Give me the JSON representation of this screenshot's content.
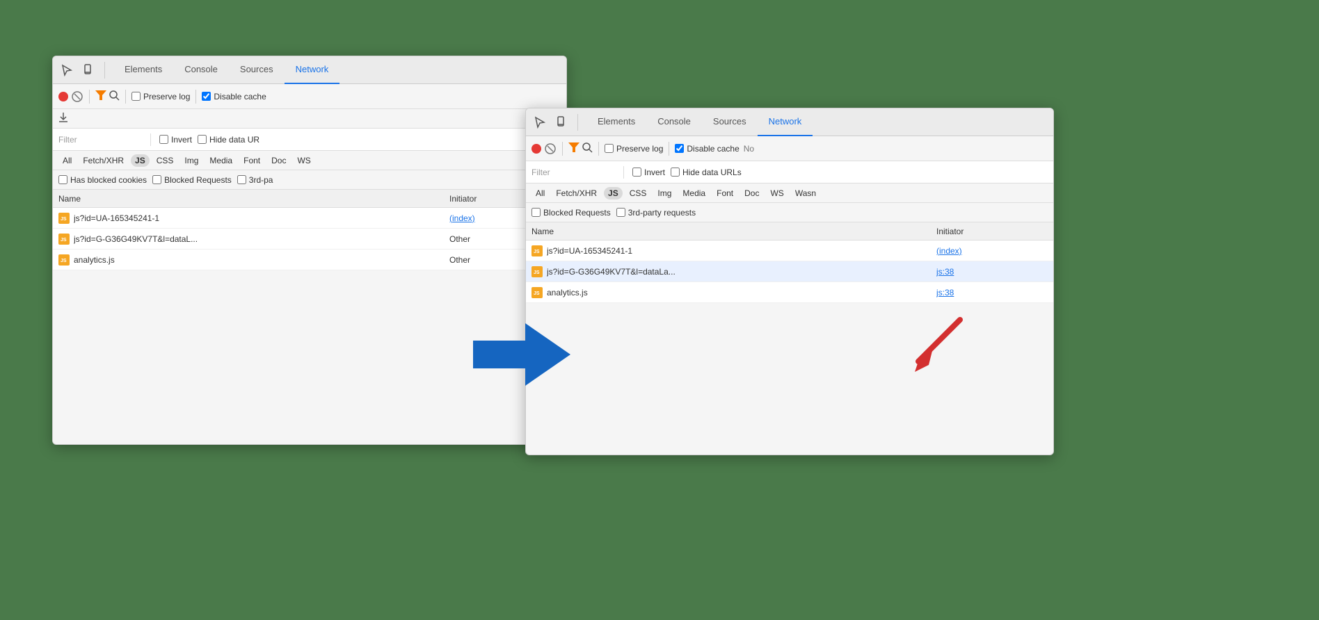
{
  "panel_back": {
    "tabs": [
      {
        "label": "Elements",
        "active": false
      },
      {
        "label": "Console",
        "active": false
      },
      {
        "label": "Sources",
        "active": false
      },
      {
        "label": "Network",
        "active": true
      }
    ],
    "toolbar": {
      "preserve_log": "Preserve log",
      "disable_cache": "Disable cache",
      "preserve_log_checked": false,
      "disable_cache_checked": true
    },
    "filter": {
      "placeholder": "Filter",
      "invert": "Invert",
      "hide_data_urls": "Hide data UR"
    },
    "type_filters": [
      "All",
      "Fetch/XHR",
      "JS",
      "CSS",
      "Img",
      "Media",
      "Font",
      "Doc",
      "WS"
    ],
    "js_active": true,
    "blocked_row": {
      "has_blocked": "Has blocked cookies",
      "blocked_requests": "Blocked Requests",
      "third_party": "3rd-pa"
    },
    "table": {
      "col_name": "Name",
      "col_initiator": "Initiator",
      "rows": [
        {
          "name": "js?id=UA-165345241-1",
          "initiator": "(index)",
          "initiator_link": true
        },
        {
          "name": "js?id=G-G36G49KV7T&l=dataL...",
          "initiator": "Other",
          "initiator_link": false
        },
        {
          "name": "analytics.js",
          "initiator": "Other",
          "initiator_link": false
        }
      ]
    }
  },
  "panel_front": {
    "tabs": [
      {
        "label": "Elements",
        "active": false
      },
      {
        "label": "Console",
        "active": false
      },
      {
        "label": "Sources",
        "active": false
      },
      {
        "label": "Network",
        "active": true
      }
    ],
    "toolbar": {
      "preserve_log": "Preserve log",
      "disable_cache": "Disable cache",
      "no_throttle": "No",
      "preserve_log_checked": false,
      "disable_cache_checked": true
    },
    "filter": {
      "placeholder": "Filter",
      "invert": "Invert",
      "hide_data_urls": "Hide data URLs"
    },
    "type_filters": [
      "All",
      "Fetch/XHR",
      "JS",
      "CSS",
      "Img",
      "Media",
      "Font",
      "Doc",
      "WS",
      "Wasn"
    ],
    "js_active": true,
    "blocked_row": {
      "blocked_requests": "Blocked Requests",
      "third_party": "3rd-party requests"
    },
    "table": {
      "col_name": "Name",
      "col_initiator": "Initiator",
      "rows": [
        {
          "name": "js?id=UA-165345241-1",
          "initiator": "(index)",
          "initiator_link": true,
          "highlighted": false
        },
        {
          "name": "js?id=G-G36G49KV7T&l=dataLa...",
          "initiator": "js:38",
          "initiator_link": true,
          "highlighted": true
        },
        {
          "name": "analytics.js",
          "initiator": "js:38",
          "initiator_link": true,
          "highlighted": false
        }
      ]
    }
  },
  "icons": {
    "cursor": "↖",
    "mobile": "⊡",
    "record": "●",
    "stop": "🚫",
    "filter": "▼",
    "search": "🔍",
    "download": "↓",
    "js_file": "JS"
  }
}
